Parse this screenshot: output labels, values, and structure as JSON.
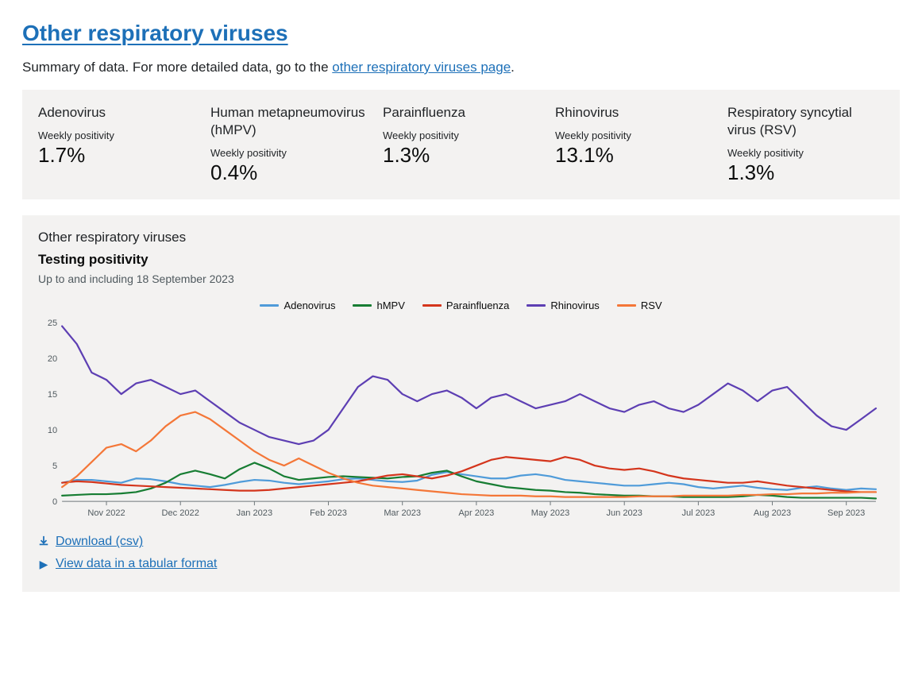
{
  "heading": "Other respiratory viruses",
  "intro_prefix": "Summary of data. For more detailed data, go to the ",
  "intro_link": "other respiratory viruses page",
  "intro_suffix": ".",
  "stats": [
    {
      "name": "Adenovirus",
      "sub": "Weekly positivity",
      "value": "1.7%"
    },
    {
      "name": "Human metapneumovirus (hMPV)",
      "sub": "Weekly positivity",
      "value": "0.4%"
    },
    {
      "name": "Parainfluenza",
      "sub": "Weekly positivity",
      "value": "1.3%"
    },
    {
      "name": "Rhinovirus",
      "sub": "Weekly positivity",
      "value": "13.1%"
    },
    {
      "name": "Respiratory syncytial virus (RSV)",
      "sub": "Weekly positivity",
      "value": "1.3%"
    }
  ],
  "chart": {
    "category": "Other respiratory viruses",
    "title": "Testing positivity",
    "date_line": "Up to and including 18 September 2023",
    "download_label": "Download (csv)",
    "view_tabular_label": "View data in a tabular format"
  },
  "chart_data": {
    "type": "line",
    "xlabel": "",
    "ylabel": "",
    "ylim": [
      0,
      25
    ],
    "y_ticks": [
      0,
      5,
      10,
      15,
      20,
      25
    ],
    "x_labels": [
      "Nov 2022",
      "Dec 2022",
      "Jan 2023",
      "Feb 2023",
      "Mar 2023",
      "Apr 2023",
      "May 2023",
      "Jun 2023",
      "Jul 2023",
      "Aug 2023",
      "Sep 2023"
    ],
    "colors": {
      "Adenovirus": "#4f9bd9",
      "hMPV": "#177d33",
      "Parainfluenza": "#d4351c",
      "Rhinovirus": "#5d3fb3",
      "RSV": "#f47738"
    },
    "series": [
      {
        "name": "Adenovirus",
        "values": [
          2.6,
          3.0,
          3.0,
          2.8,
          2.6,
          3.2,
          3.1,
          2.8,
          2.4,
          2.2,
          2.0,
          2.3,
          2.7,
          3.0,
          2.9,
          2.6,
          2.4,
          2.6,
          2.8,
          3.1,
          3.2,
          3.0,
          2.8,
          2.7,
          2.9,
          3.7,
          4.1,
          3.8,
          3.5,
          3.2,
          3.2,
          3.6,
          3.8,
          3.5,
          3.0,
          2.8,
          2.6,
          2.4,
          2.2,
          2.2,
          2.4,
          2.6,
          2.4,
          2.0,
          1.8,
          2.0,
          2.2,
          1.9,
          1.7,
          1.6,
          1.9,
          2.1,
          1.8,
          1.6,
          1.8,
          1.7
        ]
      },
      {
        "name": "hMPV",
        "values": [
          0.8,
          0.9,
          1.0,
          1.0,
          1.1,
          1.3,
          1.8,
          2.6,
          3.8,
          4.3,
          3.8,
          3.2,
          4.5,
          5.4,
          4.6,
          3.5,
          3.0,
          3.2,
          3.4,
          3.5,
          3.4,
          3.3,
          3.2,
          3.4,
          3.5,
          4.0,
          4.3,
          3.5,
          2.8,
          2.4,
          2.0,
          1.8,
          1.6,
          1.5,
          1.3,
          1.2,
          1.0,
          0.9,
          0.8,
          0.8,
          0.7,
          0.7,
          0.6,
          0.6,
          0.6,
          0.6,
          0.7,
          0.9,
          0.8,
          0.6,
          0.5,
          0.5,
          0.5,
          0.5,
          0.5,
          0.4
        ]
      },
      {
        "name": "Parainfluenza",
        "values": [
          2.6,
          2.8,
          2.7,
          2.5,
          2.3,
          2.2,
          2.1,
          2.0,
          1.9,
          1.8,
          1.7,
          1.6,
          1.5,
          1.5,
          1.6,
          1.8,
          2.0,
          2.2,
          2.4,
          2.6,
          2.8,
          3.2,
          3.6,
          3.8,
          3.5,
          3.2,
          3.6,
          4.2,
          5.0,
          5.8,
          6.2,
          6.0,
          5.8,
          5.6,
          6.2,
          5.8,
          5.0,
          4.6,
          4.4,
          4.6,
          4.2,
          3.6,
          3.2,
          3.0,
          2.8,
          2.6,
          2.6,
          2.8,
          2.5,
          2.2,
          2.0,
          1.8,
          1.6,
          1.4,
          1.3,
          1.3
        ]
      },
      {
        "name": "Rhinovirus",
        "values": [
          24.5,
          22.0,
          18.0,
          17.0,
          15.0,
          16.5,
          17.0,
          16.0,
          15.0,
          15.5,
          14.0,
          12.5,
          11.0,
          10.0,
          9.0,
          8.5,
          8.0,
          8.5,
          10.0,
          13.0,
          16.0,
          17.5,
          17.0,
          15.0,
          14.0,
          15.0,
          15.5,
          14.5,
          13.0,
          14.5,
          15.0,
          14.0,
          13.0,
          13.5,
          14.0,
          15.0,
          14.0,
          13.0,
          12.5,
          13.5,
          14.0,
          13.0,
          12.5,
          13.5,
          15.0,
          16.5,
          15.5,
          14.0,
          15.5,
          16.0,
          14.0,
          12.0,
          10.5,
          10.0,
          11.5,
          13.0
        ]
      },
      {
        "name": "RSV",
        "values": [
          2.0,
          3.5,
          5.5,
          7.5,
          8.0,
          7.0,
          8.5,
          10.5,
          12.0,
          12.5,
          11.5,
          10.0,
          8.5,
          7.0,
          5.8,
          5.0,
          6.0,
          5.0,
          4.0,
          3.2,
          2.6,
          2.2,
          2.0,
          1.8,
          1.6,
          1.4,
          1.2,
          1.0,
          0.9,
          0.8,
          0.8,
          0.8,
          0.7,
          0.7,
          0.6,
          0.6,
          0.6,
          0.6,
          0.6,
          0.7,
          0.7,
          0.7,
          0.8,
          0.8,
          0.8,
          0.8,
          0.9,
          0.9,
          1.0,
          1.0,
          1.1,
          1.1,
          1.2,
          1.2,
          1.3,
          1.3
        ]
      }
    ]
  }
}
